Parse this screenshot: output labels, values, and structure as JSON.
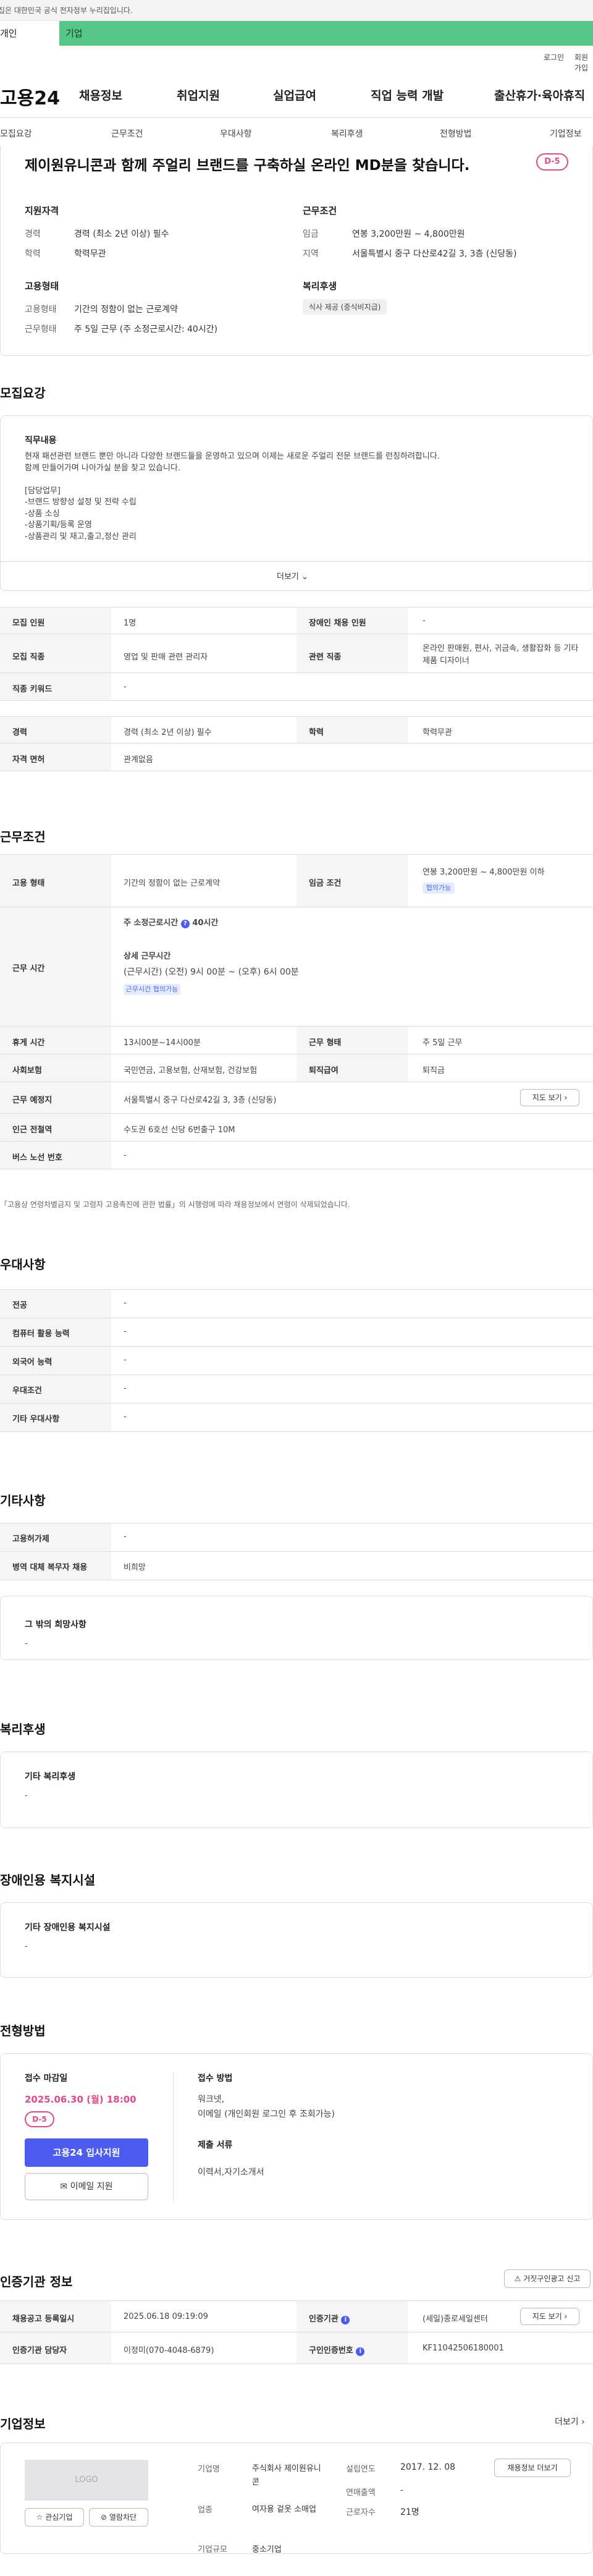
{
  "gov_banner": "이 누리집은 대한민국 공식 전자정부 누리집입니다.",
  "user_tabs": {
    "person": "개인",
    "biz": "기업"
  },
  "util": {
    "login": "로그인",
    "join": "회원가입"
  },
  "logo": "고용24",
  "gnb": [
    "채용정보",
    "취업지원",
    "실업급여",
    "직업 능력 개발",
    "출산휴가·육아휴직"
  ],
  "snb": [
    "모집요강",
    "근무조건",
    "우대사항",
    "복리후생",
    "전형방법",
    "기업정보"
  ],
  "summary": {
    "title": "제이원유니콘과 함께 주얼리 브랜드를 구축하실 온라인 MD분을 찾습니다.",
    "dday": "D-5",
    "qual_title": "지원자격",
    "career_k": "경력",
    "career_v": "경력 (최소 2년 이상) 필수",
    "edu_k": "학력",
    "edu_v": "학력무관",
    "cond_title": "근무조건",
    "pay_k": "임금",
    "pay_v": "연봉 3,200만원 ~ 4,800만원",
    "area_k": "지역",
    "area_v": "서울특별시 중구 다산로42길 3, 3층 (신당동)",
    "emp_title": "고용형태",
    "emptype_k": "고용형태",
    "emptype_v": "기간의 정함이 없는 근로계약",
    "worktype_k": "근무형태",
    "worktype_v": "주 5일 근무 (주 소정근로시간: 40시간)",
    "welfare_title": "복리후생",
    "welfare_tag": "식사 제공 (중식비지급)"
  },
  "recruit": {
    "title": "모집요강",
    "job_title": "직무내용",
    "job_text": "현재 패션관련 브랜드 뿐만 아니라 다양한 브랜드들을 운영하고 있으며 이제는 새로운 주얼리 전문 브랜드를 런칭하려합니다.\n함께 만들어가며 나아가실 분을 찾고 있습니다.\n\n[담당업무]\n-브랜드 방향성 설정 및 전략 수립\n-상품 소싱\n-상품기획/등록 운영\n-상품관리 및 재고,출고,정산 관리",
    "more": "더보기",
    "rows": {
      "count_k": "모집 인원",
      "count_v": "1명",
      "disabled_k": "장애인 채용 인원",
      "disabled_v": "-",
      "job_k": "모집 직종",
      "job_v": "영업 및 판매 관련 관리자",
      "rel_k": "관련 직종",
      "rel_v": "온라인 판매원, 편사, 귀금속, 생활잡화 등 기타 제품 디자이너",
      "kw_k": "직종 키워드",
      "kw_v": "-",
      "career_k": "경력",
      "career_v": "경력 (최소 2년 이상) 필수",
      "edu_k": "학력",
      "edu_v": "학력무관",
      "lic_k": "자격 면허",
      "lic_v": "관계없음"
    }
  },
  "work": {
    "title": "근무조건",
    "emp_k": "고용 형태",
    "emp_v": "기간의 정함이 없는 근로계약",
    "pay_k": "임금 조건",
    "pay_v": "연봉 3,200만원 ~ 4,800만원 이하",
    "pay_tag": "협의가능",
    "hours_k": "근무 시간",
    "hours_main": "주 소정근로시간",
    "hours_val": "40시간",
    "hours_detail_t": "상세 근무시간",
    "hours_detail": "(근무시간) (오전) 9시 00분 ~ (오후) 6시 00분",
    "hours_tag": "근무시간 협의가능",
    "rest_k": "휴게 시간",
    "rest_v": "13시00분~14시00분",
    "shift_k": "근무 형태",
    "shift_v": "주 5일 근무",
    "ins_k": "사회보험",
    "ins_v": "국민연금, 고용보험, 산재보험, 건강보험",
    "retire_k": "퇴직급여",
    "retire_v": "퇴직금",
    "place_k": "근무 예정지",
    "place_v": "서울특별시 중구 다산로42길 3, 3층 (신당동)",
    "map_btn": "지도 보기",
    "subway_k": "인근 전철역",
    "subway_v": "수도권 6호선 신당 6번출구 10M",
    "bus_k": "버스 노선 번호",
    "bus_v": "-",
    "note": "「고용상 연령차별금지 및 고령자 고용촉진에 관한 법률」의 시행령에 따라 채용정보에서 연령이 삭제되었습니다."
  },
  "pref": {
    "title": "우대사항",
    "rows": [
      {
        "k": "전공",
        "v": "-"
      },
      {
        "k": "컴퓨터 활용 능력",
        "v": "-"
      },
      {
        "k": "외국어 능력",
        "v": "-"
      },
      {
        "k": "우대조건",
        "v": "-"
      },
      {
        "k": "기타 우대사항",
        "v": "-"
      }
    ]
  },
  "etc": {
    "title": "기타사항",
    "rows": [
      {
        "k": "고용허가제",
        "v": "-"
      },
      {
        "k": "병역 대체 복무자 채용",
        "v": "비희망"
      }
    ],
    "hope_title": "그 밖의 희망사항",
    "hope_v": "-"
  },
  "welfare": {
    "title": "복리후생",
    "box_title": "기타 복리후생",
    "box_v": "-"
  },
  "disabled": {
    "title": "장애인용 복지시설",
    "box_title": "기타 장애인용 복지시설",
    "box_v": "-"
  },
  "apply": {
    "title": "전형방법",
    "deadline_t": "접수 마감일",
    "deadline": "2025.06.30 (월) 18:00",
    "dday": "D-5",
    "apply_btn": "고용24 입사지원",
    "email_btn": "이메일 지원",
    "method_t": "접수 방법",
    "method_v1": "워크넷,",
    "method_v2": "이메일 (개인회원 로그인 후 조회가능)",
    "docs_t": "제출 서류",
    "docs_v": "이력서,자기소개서"
  },
  "cert": {
    "title": "인증기관 정보",
    "report_btn": "거짓구인광고 신고",
    "reg_k": "채용공고 등록일시",
    "reg_v": "2025.06.18 09:19:09",
    "org_k": "인증기관",
    "org_v": "(세일)종로세일센터",
    "org_map": "지도 보기",
    "mgr_k": "인증기관 담당자",
    "mgr_v": "이정미(070-4048-6879)",
    "num_k": "구인인증번호",
    "num_v": "KF11042506180001"
  },
  "company": {
    "title": "기업정보",
    "more": "더보기",
    "logo_ph": "LOGO",
    "fav_btn": "관심기업",
    "block_btn": "열람차단",
    "name_k": "기업명",
    "name_v": "주식회사 제이원유니콘",
    "est_k": "설립연도",
    "est_v": "2017. 12. 08",
    "info_btn": "채용정보 더보기",
    "ind_k": "업종",
    "ind_v": "여자용 겉옷 소매업",
    "sales_k": "연매출액",
    "sales_v": "-",
    "emp_k": "근로자수",
    "emp_v": "21명",
    "size_k": "기업규모",
    "size_v": "중소기업"
  }
}
